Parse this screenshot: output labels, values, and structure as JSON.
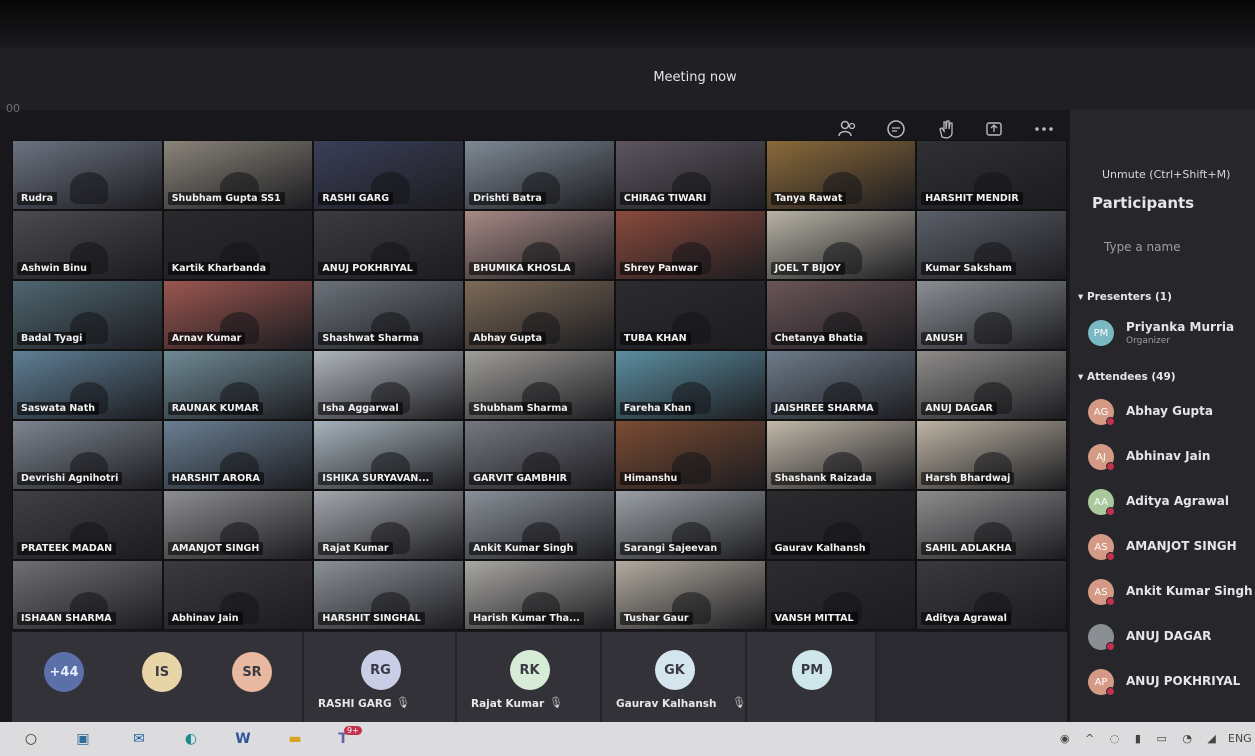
{
  "meeting": {
    "title": "Meeting now",
    "time_left": "00"
  },
  "toolbar": {
    "icons": [
      "people-icon",
      "chat-icon",
      "raise-hand-icon",
      "share-tray-icon",
      "more-icon",
      "camera-off-icon",
      "mic-icon",
      "share-screen-icon"
    ],
    "unmute_tooltip": "Unmute (Ctrl+Shift+M)"
  },
  "tiles": [
    {
      "name": "Rudra",
      "bg": "#6b7280"
    },
    {
      "name": "Shubham Gupta SS1",
      "bg": "#8a857a"
    },
    {
      "name": "RASHI GARG",
      "bg": "#3a3f58"
    },
    {
      "name": "Drishti Batra",
      "bg": "#7f8a96"
    },
    {
      "name": "CHIRAG TIWARI",
      "bg": "#5d5560"
    },
    {
      "name": "Tanya Rawat",
      "bg": "#8b6a3a"
    },
    {
      "name": "HARSHIT MENDIR",
      "bg": "#2f3033"
    },
    {
      "name": "Ashwin Binu",
      "bg": "#4a4a4f"
    },
    {
      "name": "Kartik Kharbanda",
      "bg": "#2a2a2e"
    },
    {
      "name": "ANUJ POKHRIYAL",
      "bg": "#3b3b40"
    },
    {
      "name": "BHUMIKA KHOSLA",
      "bg": "#a78a86"
    },
    {
      "name": "Shrey Panwar",
      "bg": "#8a4a3c"
    },
    {
      "name": "JOEL T BIJOY",
      "bg": "#b8b3a6"
    },
    {
      "name": "Kumar Saksham",
      "bg": "#5b5f68"
    },
    {
      "name": "Badal Tyagi",
      "bg": "#4f6670"
    },
    {
      "name": "Arnav Kumar",
      "bg": "#9b5650"
    },
    {
      "name": "Shashwat Sharma",
      "bg": "#6c727b"
    },
    {
      "name": "Abhay Gupta",
      "bg": "#7d6a58"
    },
    {
      "name": "TUBA KHAN",
      "bg": "#2c2c30"
    },
    {
      "name": "Chetanya Bhatia",
      "bg": "#6a5557"
    },
    {
      "name": "ANUSH",
      "bg": "#8a8f94"
    },
    {
      "name": "Saswata Nath",
      "bg": "#5f7f95"
    },
    {
      "name": "RAUNAK KUMAR",
      "bg": "#6f8a95"
    },
    {
      "name": "Isha Aggarwal",
      "bg": "#b0b5bd"
    },
    {
      "name": "Shubham Sharma",
      "bg": "#a09e9a"
    },
    {
      "name": "Fareha Khan",
      "bg": "#5b8ea0"
    },
    {
      "name": "JAISHREE SHARMA",
      "bg": "#6e7b8a"
    },
    {
      "name": "ANUJ DAGAR",
      "bg": "#8e8c8a"
    },
    {
      "name": "Devrishi Agnihotri",
      "bg": "#7d8590"
    },
    {
      "name": "HARSHIT ARORA",
      "bg": "#6a7f93"
    },
    {
      "name": "ISHIKA SURYAVAN...",
      "bg": "#a6b4bb"
    },
    {
      "name": "GARVIT GAMBHIR",
      "bg": "#757780"
    },
    {
      "name": "Himanshu",
      "bg": "#7a4b32"
    },
    {
      "name": "Shashank Raizada",
      "bg": "#c2b9aa"
    },
    {
      "name": "Harsh Bhardwaj",
      "bg": "#bdb4a4"
    },
    {
      "name": "PRATEEK MADAN",
      "bg": "#3f3f44"
    },
    {
      "name": "AMANJOT SINGH",
      "bg": "#8d8e8f"
    },
    {
      "name": "Rajat Kumar",
      "bg": "#a3a7ad"
    },
    {
      "name": "Ankit Kumar Singh",
      "bg": "#8a9099"
    },
    {
      "name": "Sarangi Sajeevan",
      "bg": "#9ba1a5"
    },
    {
      "name": "Gaurav Kalhansh",
      "bg": "#2b2b2e"
    },
    {
      "name": "SAHIL ADLAKHA",
      "bg": "#8d8c8d"
    },
    {
      "name": "ISHAAN SHARMA",
      "bg": "#6e6e74"
    },
    {
      "name": "Abhinav Jain",
      "bg": "#3a3a3f"
    },
    {
      "name": "HARSHIT SINGHAL",
      "bg": "#8b9097"
    },
    {
      "name": "Harish Kumar Tha...",
      "bg": "#a9a7a3"
    },
    {
      "name": "Tushar Gaur",
      "bg": "#b2aba0"
    },
    {
      "name": "VANSH MITTAL",
      "bg": "#2d2d31"
    },
    {
      "name": "Aditya Agrawal",
      "bg": "#3a3a3e"
    }
  ],
  "bottom_strip": [
    {
      "initials": "+44",
      "color": "#5b6fa8",
      "name": ""
    },
    {
      "initials": "IS",
      "color": "#e7d5a8",
      "name": ""
    },
    {
      "initials": "SR",
      "color": "#e8b9a0",
      "name": ""
    },
    {
      "initials": "RG",
      "color": "#c9cde6",
      "name": "RASHI GARG"
    },
    {
      "initials": "RK",
      "color": "#d7ecd7",
      "name": "Rajat Kumar"
    },
    {
      "initials": "GK",
      "color": "#d5e5ee",
      "name": "Gaurav Kalhansh"
    },
    {
      "initials": "PM",
      "color": "#cfe7ea",
      "name": ""
    }
  ],
  "panel": {
    "title": "Participants",
    "search_placeholder": "Type a name",
    "presenters_heading": "Presenters (1)",
    "presenter": {
      "initials": "PM",
      "name": "Priyanka Murria",
      "role": "Organizer",
      "color": "#7ab8c2"
    },
    "attendees_heading": "Attendees (49)",
    "attendees": [
      {
        "initials": "AG",
        "name": "Abhay Gupta",
        "color": "#d49a86"
      },
      {
        "initials": "AJ",
        "name": "Abhinav Jain",
        "color": "#d49a86"
      },
      {
        "initials": "AA",
        "name": "Aditya Agrawal",
        "color": "#a9c99c"
      },
      {
        "initials": "AS",
        "name": "AMANJOT SINGH",
        "color": "#d49a86"
      },
      {
        "initials": "AS",
        "name": "Ankit Kumar Singh",
        "color": "#d49a86"
      },
      {
        "initials": "",
        "name": "ANUJ DAGAR",
        "color": "#8a8f94"
      },
      {
        "initials": "AP",
        "name": "ANUJ POKHRIYAL",
        "color": "#d49a86"
      }
    ]
  },
  "taskbar": {
    "icons": [
      "search-circle-icon",
      "store-icon",
      "mail-icon",
      "edge-icon",
      "word-icon",
      "file-explorer-icon",
      "teams-icon"
    ],
    "teams_badge": "9+",
    "tray_text": "ENG"
  }
}
